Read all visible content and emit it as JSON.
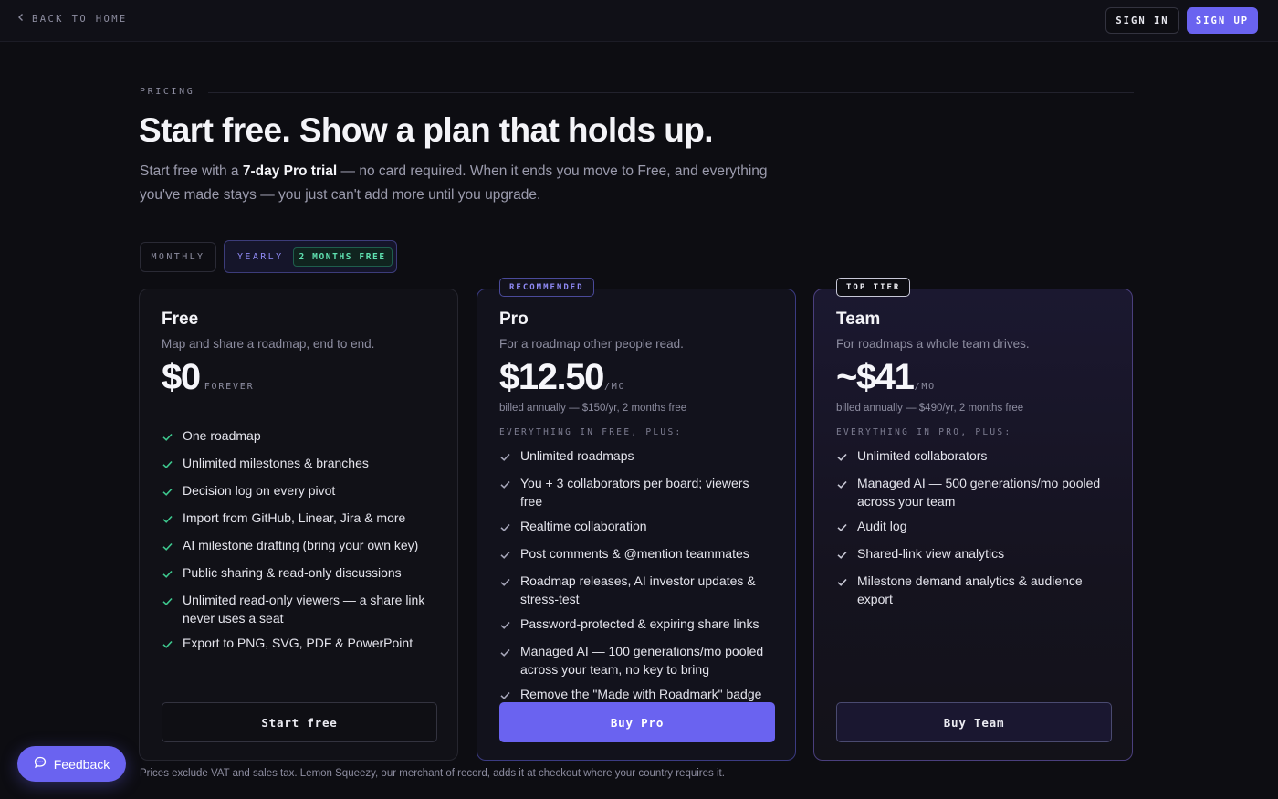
{
  "nav": {
    "back_label": "BACK TO HOME",
    "sign_in": "SIGN IN",
    "sign_up": "SIGN UP"
  },
  "header": {
    "eyebrow": "PRICING",
    "title": "Start free. Show a plan that holds up.",
    "subtitle_pre": "Start free with a ",
    "subtitle_bold": "7-day Pro trial",
    "subtitle_post": " — no card required. When it ends you move to Free, and everything you've made stays — you just can't add more until you upgrade."
  },
  "billing_toggle": {
    "monthly": "MONTHLY",
    "yearly": "YEARLY",
    "yearly_badge": "2 MONTHS FREE",
    "selected": "YEARLY"
  },
  "plans": {
    "free": {
      "name": "Free",
      "description": "Map and share a roadmap, end to end.",
      "price": "$0",
      "price_unit": "FOREVER",
      "features": [
        "One roadmap",
        "Unlimited milestones & branches",
        "Decision log on every pivot",
        "Import from GitHub, Linear, Jira & more",
        "AI milestone drafting (bring your own key)",
        "Public sharing & read-only discussions",
        "Unlimited read-only viewers — a share link never uses a seat",
        "Export to PNG, SVG, PDF & PowerPoint"
      ],
      "cta": "Start free"
    },
    "pro": {
      "ribbon": "RECOMMENDED",
      "name": "Pro",
      "description": "For a roadmap other people read.",
      "price": "$12.50",
      "price_unit": "/MO",
      "billing": "billed annually — $150/yr, 2 months free",
      "inherits": "EVERYTHING IN FREE, PLUS:",
      "features": [
        "Unlimited roadmaps",
        "You + 3 collaborators per board; viewers free",
        "Realtime collaboration",
        "Post comments & @mention teammates",
        "Roadmap releases, AI investor updates & stress-test",
        "Password-protected & expiring share links",
        "Managed AI — 100 generations/mo pooled across your team, no key to bring",
        "Remove the \"Made with Roadmark\" badge"
      ],
      "cta": "Buy Pro"
    },
    "team": {
      "ribbon": "TOP TIER",
      "name": "Team",
      "description": "For roadmaps a whole team drives.",
      "price": "~$41",
      "price_unit": "/MO",
      "billing": "billed annually — $490/yr, 2 months free",
      "inherits": "EVERYTHING IN PRO, PLUS:",
      "features": [
        "Unlimited collaborators",
        "Managed AI — 500 generations/mo pooled across your team",
        "Audit log",
        "Shared-link view analytics",
        "Milestone demand analytics & audience export"
      ],
      "cta": "Buy Team"
    }
  },
  "footnote": "Prices exclude VAT and sales tax. Lemon Squeezy, our merchant of record, adds it at checkout where your country requires it.",
  "feedback": "Feedback",
  "colors": {
    "accent": "#6a63f0",
    "check_free": "#3ec98f",
    "background": "#0d0d12"
  }
}
